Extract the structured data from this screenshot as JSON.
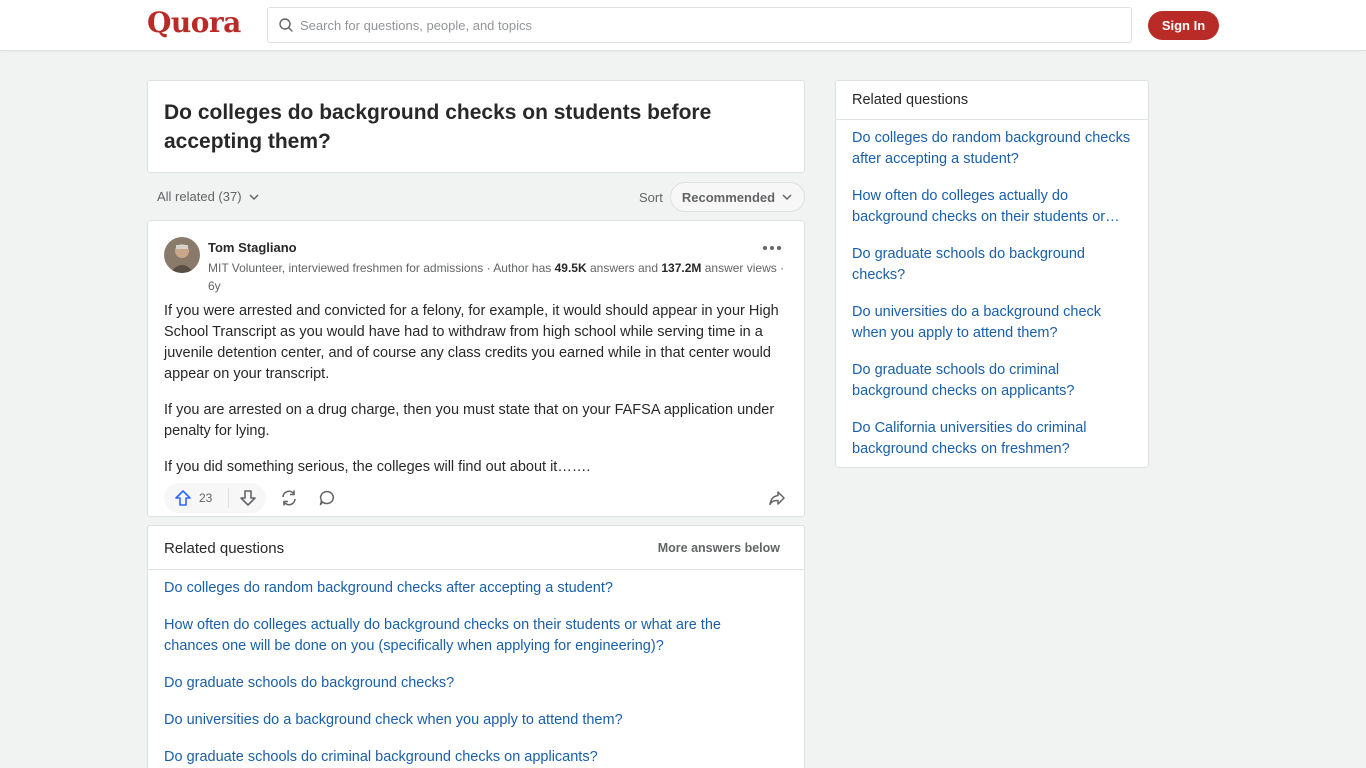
{
  "header": {
    "logo": "Quora",
    "search_placeholder": "Search for questions, people, and topics",
    "signin_label": "Sign In"
  },
  "question": {
    "title": "Do colleges do background checks on students before accepting them?"
  },
  "filters": {
    "all_related": "All related (37)",
    "sort_label": "Sort",
    "sort_value": "Recommended"
  },
  "answer": {
    "author": "Tom Stagliano",
    "credential_prefix": "MIT Volunteer, interviewed freshmen for admissions · Author has ",
    "answers_count": "49.5K",
    "credential_mid": " answers and ",
    "views_count": "137.2M",
    "credential_suffix": " answer views · 6y",
    "paragraphs": [
      "If you were arrested and convicted for a felony, for example, it would should appear in your High School Transcript as you would have had to withdraw from high school while serving time in a juvenile detention center, and of course any class credits you earned while in that center would appear on your transcript.",
      "If you are arrested on a drug charge, then you must state that on your FAFSA application under penalty for lying.",
      "If you did something serious, the colleges will find out about it……."
    ],
    "upvotes": "23"
  },
  "related_main": {
    "title": "Related questions",
    "more_label": "More answers below",
    "items": [
      "Do colleges do random background checks after accepting a student?",
      "How often do colleges actually do background checks on their students or what are the chances one will be done on you (specifically when applying for engineering)?",
      "Do graduate schools do background checks?",
      "Do universities do a background check when you apply to attend them?",
      "Do graduate schools do criminal background checks on applicants?"
    ]
  },
  "related_side": {
    "title": "Related questions",
    "items": [
      "Do colleges do random background checks after accepting a student?",
      "How often do colleges actually do background checks on their students or…",
      "Do graduate schools do background checks?",
      "Do universities do a background check when you apply to attend them?",
      "Do graduate schools do criminal background checks on applicants?",
      "Do California universities do criminal background checks on freshmen?"
    ]
  },
  "colors": {
    "brand": "#b92b27",
    "link": "#195faa",
    "upvote": "#2e69ff"
  }
}
